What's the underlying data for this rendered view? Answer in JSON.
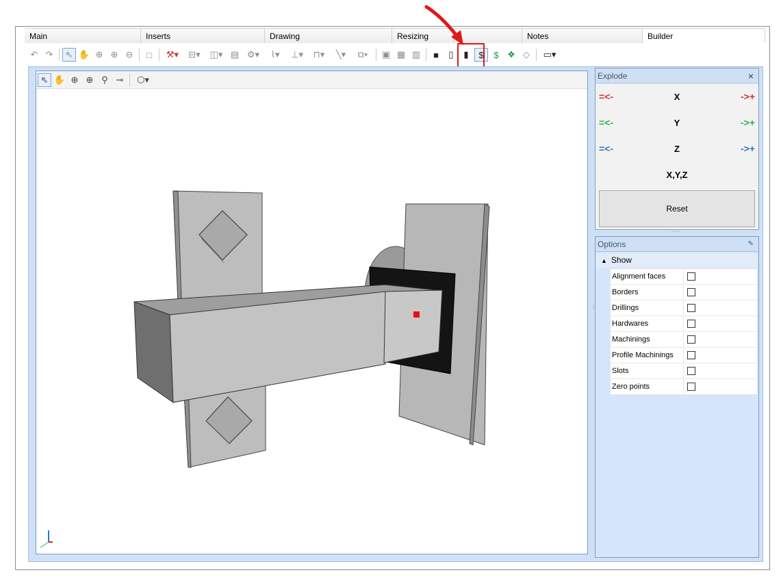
{
  "tabs": [
    "Main",
    "Inserts",
    "Drawing",
    "Resizing",
    "",
    "Notes",
    "Builder"
  ],
  "active_tab": "Builder",
  "toolbar_icons": [
    "undo-icon",
    "redo-icon",
    "select-icon",
    "pan-icon",
    "zoom-fit-icon",
    "zoom-in-icon",
    "zoom-out-icon",
    "box-icon",
    "drill-icon",
    "horizontal-panel-icon",
    "vertical-panel-icon",
    "shelf-icon",
    "hardware-icon",
    "profile-icon",
    "joint-icon",
    "frame-icon",
    "line-icon",
    "copy-icon",
    "render-icon",
    "grid-icon",
    "columns-icon",
    "solid-cube-icon",
    "panel-thickness-icon",
    "cylinder-icon",
    "money-bag-icon",
    "dollar-icon",
    "color-cubes-icon",
    "eraser-icon",
    "window-layout-icon"
  ],
  "highlighted_icon": "money-bag-icon",
  "viewport": {
    "toolbar_icons": [
      "select-icon",
      "pan-icon",
      "zoom-fit-icon",
      "zoom-window-icon",
      "zoom-in-icon",
      "orbit-icon",
      "view-cube-icon"
    ]
  },
  "explode": {
    "title": "Explode",
    "close": "×",
    "rows": [
      {
        "label": "X",
        "color": "#d62f2f",
        "left": "=<-",
        "right": "->+"
      },
      {
        "label": "Y",
        "color": "#2bb24a",
        "left": "=<-",
        "right": "->+"
      },
      {
        "label": "Z",
        "color": "#2f74c6",
        "left": "=<-",
        "right": "->+"
      },
      {
        "label": "X,Y,Z",
        "color": "",
        "left": "",
        "right": ""
      }
    ],
    "reset_label": "Reset"
  },
  "options": {
    "title": "Options",
    "pin": "📌",
    "section": "Show",
    "items": [
      {
        "name": "Alignment faces",
        "checked": false
      },
      {
        "name": "Borders",
        "checked": false
      },
      {
        "name": "Drillings",
        "checked": false
      },
      {
        "name": "Hardwares",
        "checked": false
      },
      {
        "name": "Machinings",
        "checked": false
      },
      {
        "name": "Profile Machinings",
        "checked": false
      },
      {
        "name": "Slots",
        "checked": false
      },
      {
        "name": "Zero points",
        "checked": false
      }
    ]
  },
  "colors": {
    "annotation_red": "#e11818",
    "marker_red": "#ee1111",
    "workspace_blue": "#cfe1f6"
  }
}
